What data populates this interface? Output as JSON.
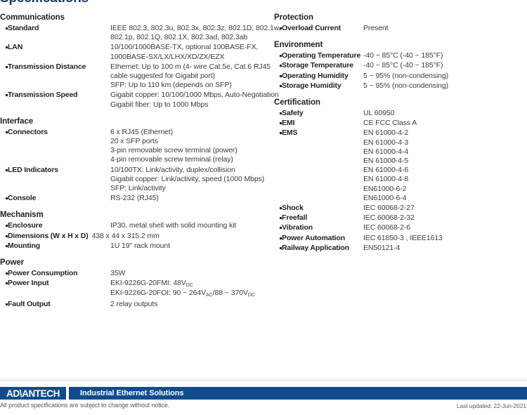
{
  "page": {
    "title": "Specifications"
  },
  "left_column": [
    {
      "title": "Communications",
      "rows": [
        {
          "label": "Standard",
          "lines": [
            "IEEE 802.3, 802.3u, 802.3x, 802.3z, 802.1D, 802.1w,",
            "802.1p, 802.1Q, 802.1X, 802.3ad, 802.3ab"
          ]
        },
        {
          "label": "LAN",
          "lines": [
            "10/100/1000BASE-TX, optional 100BASE-FX,",
            "1000BASE-SX/LX/LHX/XD/ZX/EZX"
          ]
        },
        {
          "label": "Transmission Distance",
          "lines": [
            "Ethernet: Up to 100 m (4- wire Cat.5e, Cat.6 RJ45",
            "cable suggested for Gigabit port)",
            "SFP: Up to 110 km (depends on SFP)"
          ]
        },
        {
          "label": "Transmission Speed",
          "lines": [
            "Gigabit copper: 10/100/1000 Mbps, Auto-Negotiation",
            "Gigabit fiber: Up to 1000 Mbps"
          ]
        }
      ]
    },
    {
      "title": "Interface",
      "rows": [
        {
          "label": "Connectors",
          "lines": [
            "6 x RJ45 (Ethernet)",
            "20 x SFP ports",
            "3-pin removable screw terminal (power)",
            "4-pin removable screw terminal (relay)"
          ]
        },
        {
          "label": "LED Indicators",
          "lines": [
            "10/100TX: Link/activity, duplex/collision",
            "Gigabit copper: Link/activity, speed (1000 Mbps)",
            "SFP: Link/activity"
          ]
        },
        {
          "label": "Console",
          "lines": [
            "RS-232 (RJ45)"
          ]
        }
      ]
    },
    {
      "title": "Mechanism",
      "rows": [
        {
          "label": "Enclosure",
          "lines": [
            "IP30, metal shell with solid mounting kit"
          ]
        },
        {
          "label": "Dimensions (W x H x D)",
          "wide": true,
          "lines": [
            "438 x 44 x 315.2 mm"
          ]
        },
        {
          "label": "Mounting",
          "lines": [
            "1U 19\" rack mount"
          ]
        }
      ]
    },
    {
      "title": "Power",
      "rows": [
        {
          "label": "Power Consumption",
          "lines": [
            "35W"
          ]
        },
        {
          "label": "Power Input",
          "lines_html": [
            "EKI-9226G-20FMI: 48V<sub>DC</sub>",
            "EKI-9226G-20FOI: 90 ~ 264V<sub>AC</sub>/88 ~ 370V<sub>DC</sub>"
          ]
        },
        {
          "label": "Fault Output",
          "lines": [
            "2 relay outputs"
          ]
        }
      ]
    }
  ],
  "right_column": [
    {
      "title": "Protection",
      "rows": [
        {
          "label": "Overload Current",
          "lines": [
            "Present"
          ]
        }
      ]
    },
    {
      "title": "Environment",
      "rows": [
        {
          "label": "Operating Temperature",
          "lines": [
            "-40 ~ 85°C (-40 ~ 185°F)"
          ]
        },
        {
          "label": "Storage Temperature",
          "lines": [
            "-40 ~ 85°C (-40 ~ 185°F)"
          ]
        },
        {
          "label": "Operating Humidity",
          "lines": [
            "5 ~ 95% (non-condensing)"
          ]
        },
        {
          "label": "Storage Humidity",
          "lines": [
            "5 ~ 95% (non-condensing)"
          ]
        }
      ]
    },
    {
      "title": "Certification",
      "rows": [
        {
          "label": "Safety",
          "lines": [
            "UL 60950"
          ]
        },
        {
          "label": "EMI",
          "lines": [
            "CE FCC Class A"
          ]
        },
        {
          "label": "EMS",
          "lines": [
            "EN 61000-4-2",
            "EN 61000-4-3",
            "EN 61000-4-4",
            "EN 61000-4-5",
            "EN 61000-4-6",
            "EN 61000-4-8",
            "EN61000-6-2",
            "EN61000-6-4"
          ]
        },
        {
          "label": "Shock",
          "lines": [
            "IEC 60068-2-27"
          ]
        },
        {
          "label": "Freefall",
          "lines": [
            "IEC 60068-2-32"
          ]
        },
        {
          "label": "Vibration",
          "lines": [
            "IEC 60068-2-6"
          ]
        },
        {
          "label": "Power Automation",
          "lines": [
            "IEC 61850-3 , IEEE1613"
          ]
        },
        {
          "label": "Railway Application",
          "lines": [
            "EN50121-4"
          ]
        }
      ]
    }
  ],
  "footer": {
    "logo_text": "AD\\ANTECH",
    "banner_text": "Industrial Ethernet Solutions",
    "disclaimer": "All product specifications are subject to change without notice.",
    "last_updated": "Last updated: 22-Jun-2021",
    "banner_color": "#0f4c8c",
    "title_color": "#1b3a63"
  }
}
